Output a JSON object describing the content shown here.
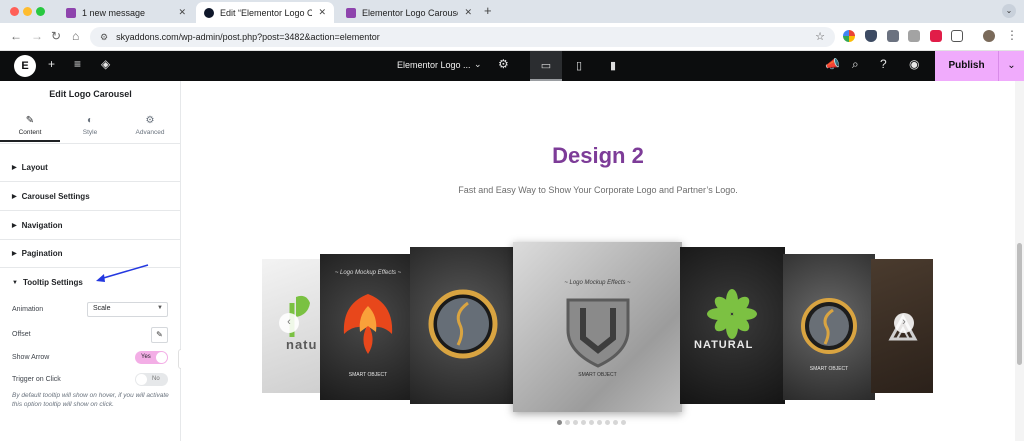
{
  "browser": {
    "tabs": [
      {
        "title": "1 new message",
        "favicon_color": "#8e44ad"
      },
      {
        "title": "Edit “Elementor Logo Carousel”",
        "favicon_color": "#0f172a"
      },
      {
        "title": "Elementor Logo Carousel Wi",
        "favicon_color": "#8e44ad"
      }
    ],
    "new_tab": "+",
    "close": "✕",
    "url": "skyaddons.com/wp-admin/post.php?post=3482&action=elementor"
  },
  "editor": {
    "logo": "E",
    "doc_title": "Elementor Logo ...",
    "publish_label": "Publish",
    "publish_color": "#f0abfc"
  },
  "panel": {
    "title": "Edit Logo Carousel",
    "tabs": [
      {
        "label": "Content",
        "icon": "pencil-icon"
      },
      {
        "label": "Style",
        "icon": "contrast-icon"
      },
      {
        "label": "Advanced",
        "icon": "gear-icon"
      }
    ],
    "sections": [
      "Layout",
      "Carousel Settings",
      "Navigation",
      "Pagination",
      "Tooltip Settings"
    ],
    "controls": {
      "animation_label": "Animation",
      "animation_value": "Scale",
      "offset_label": "Offset",
      "show_arrow_label": "Show Arrow",
      "show_arrow_value": "Yes",
      "trigger_label": "Trigger on Click",
      "trigger_value": "No"
    },
    "help_text": "By default tooltip will show on hover, if you will activate this option tooltip will show on click."
  },
  "canvas": {
    "title": "Design 2",
    "title_color": "#7d3c98",
    "subtitle": "Fast and Easy Way to Show Your Corporate Logo and Partner’s Logo.",
    "cards": [
      {
        "name": "natural-green-card",
        "text": "natu"
      },
      {
        "name": "phoenix-card",
        "caption": "SMART OBJECT"
      },
      {
        "name": "gold-face-card"
      },
      {
        "name": "shield-logo-card",
        "caption": "SMART OBJECT"
      },
      {
        "name": "natural-leaf-card",
        "text": "NATURAL"
      },
      {
        "name": "face-card-right",
        "caption": "SMART OBJECT"
      },
      {
        "name": "triangle-logo-card"
      }
    ],
    "pagination": {
      "total": 9,
      "active": 0
    }
  }
}
